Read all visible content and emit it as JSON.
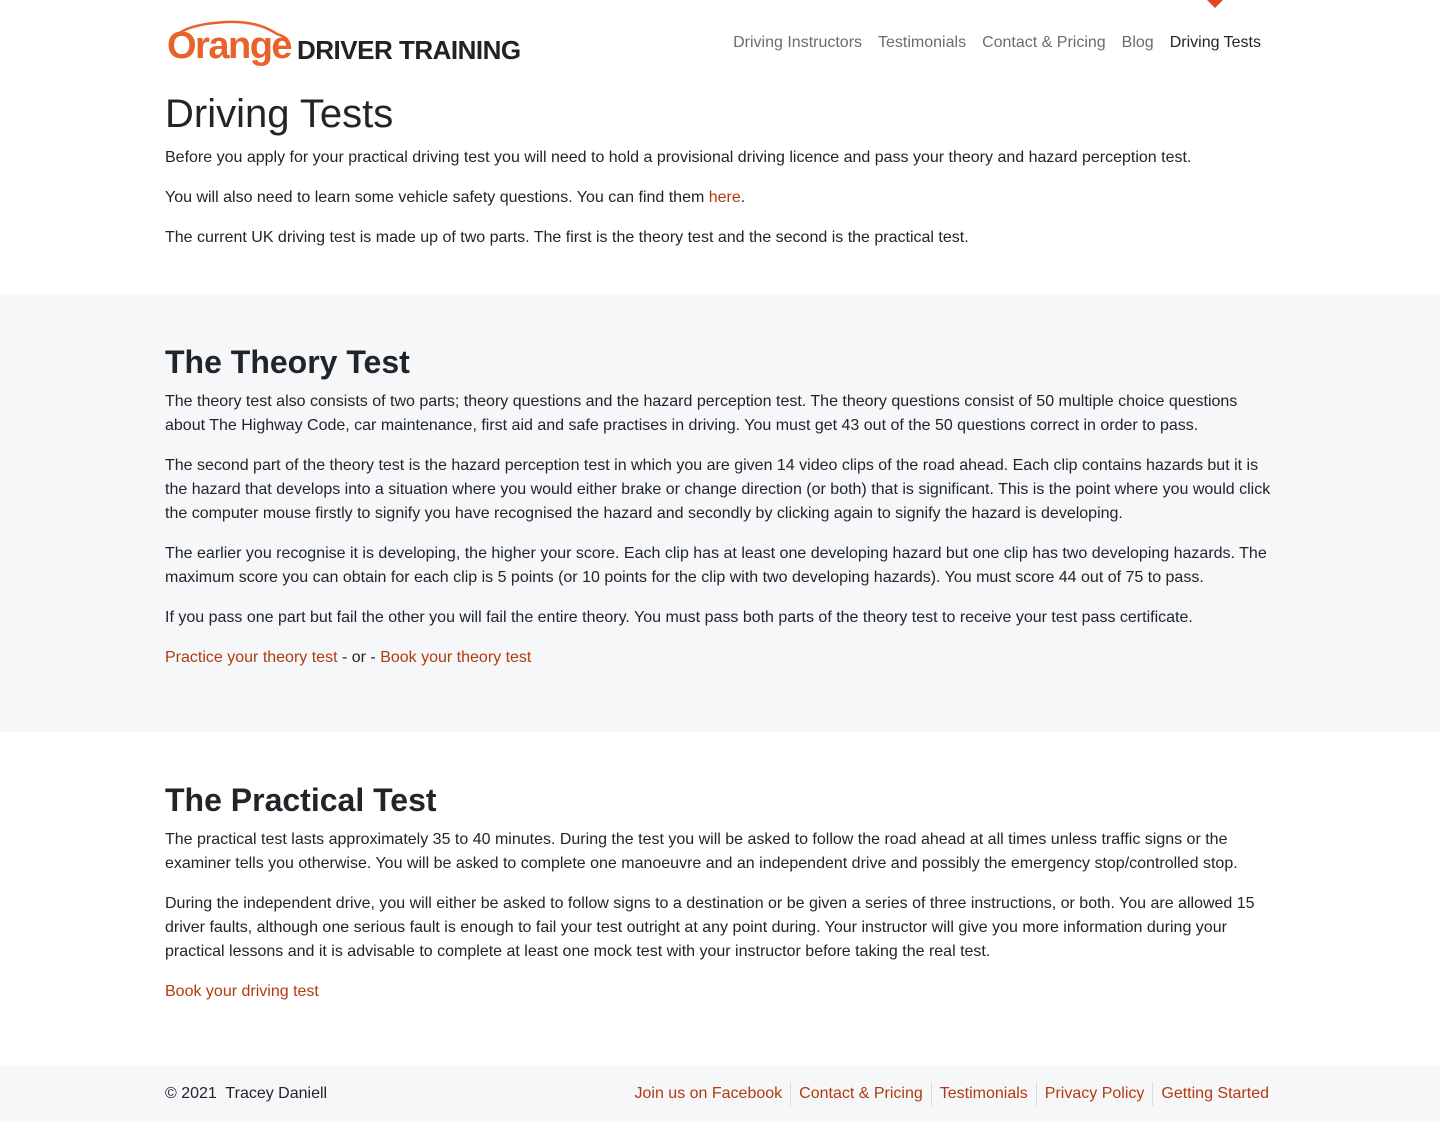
{
  "brand": {
    "logo_word": "Orange",
    "logo_rest": "DRIVER TRAINING",
    "accent_color": "#e8622c",
    "link_color": "#b33a10"
  },
  "nav": {
    "items": [
      {
        "label": "Driving Instructors",
        "active": false
      },
      {
        "label": "Testimonials",
        "active": false
      },
      {
        "label": "Contact & Pricing",
        "active": false
      },
      {
        "label": "Blog",
        "active": false
      },
      {
        "label": "Driving Tests",
        "active": true
      }
    ]
  },
  "intro": {
    "title": "Driving Tests",
    "p1": "Before you apply for your practical driving test you will need to hold a provisional driving licence and pass your theory and hazard perception test.",
    "p2_before": "You will also need to learn some vehicle safety questions. You can find them ",
    "p2_link": "here",
    "p2_after": ".",
    "p3": "The current UK driving test is made up of two parts. The first is the theory test and the second is the practical test."
  },
  "theory": {
    "heading": "The Theory Test",
    "p1": "The theory test also consists of two parts; theory questions and the hazard perception test. The theory questions consist of 50 multiple choice questions about The Highway Code, car maintenance, first aid and safe practises in driving. You must get 43 out of the 50 questions correct in order to pass.",
    "p2": "The second part of the theory test is the hazard perception test in which you are given 14 video clips of the road ahead. Each clip contains hazards but it is the hazard that develops into a situation where you would either brake or change direction (or both) that is significant. This is the point where you would click the computer mouse firstly to signify you have recognised the hazard and secondly by clicking again to signify the hazard is developing.",
    "p3": "The earlier you recognise it is developing, the higher your score. Each clip has at least one developing hazard but one clip has two developing hazards. The maximum score you can obtain for each clip is 5 points (or 10 points for the clip with two developing hazards). You must score 44 out of 75 to pass.",
    "p4": "If you pass one part but fail the other you will fail the entire theory. You must pass both parts of the theory test to receive your test pass certificate.",
    "link_practice": "Practice your theory test",
    "separator": " - or - ",
    "link_book": "Book your theory test"
  },
  "practical": {
    "heading": "The Practical Test",
    "p1": "The practical test lasts approximately 35 to 40 minutes. During the test you will be asked to follow the road ahead at all times unless traffic signs or the examiner tells you otherwise. You will be asked to complete one manoeuvre and an independent drive and possibly the emergency stop/controlled stop.",
    "p2": "During the independent drive, you will either be asked to follow signs to a destination or be given a series of three instructions, or both. You are allowed 15 driver faults, although one serious fault is enough to fail your test outright at any point during. Your instructor will give you more information during your practical lessons and it is advisable to complete at least one mock test with your instructor before taking the real test.",
    "link_book": "Book your driving test"
  },
  "footer": {
    "copyright": "© 2021  Tracey Daniell",
    "links": [
      "Join us on Facebook",
      "Contact & Pricing",
      "Testimonials",
      "Privacy Policy",
      "Getting Started"
    ]
  }
}
